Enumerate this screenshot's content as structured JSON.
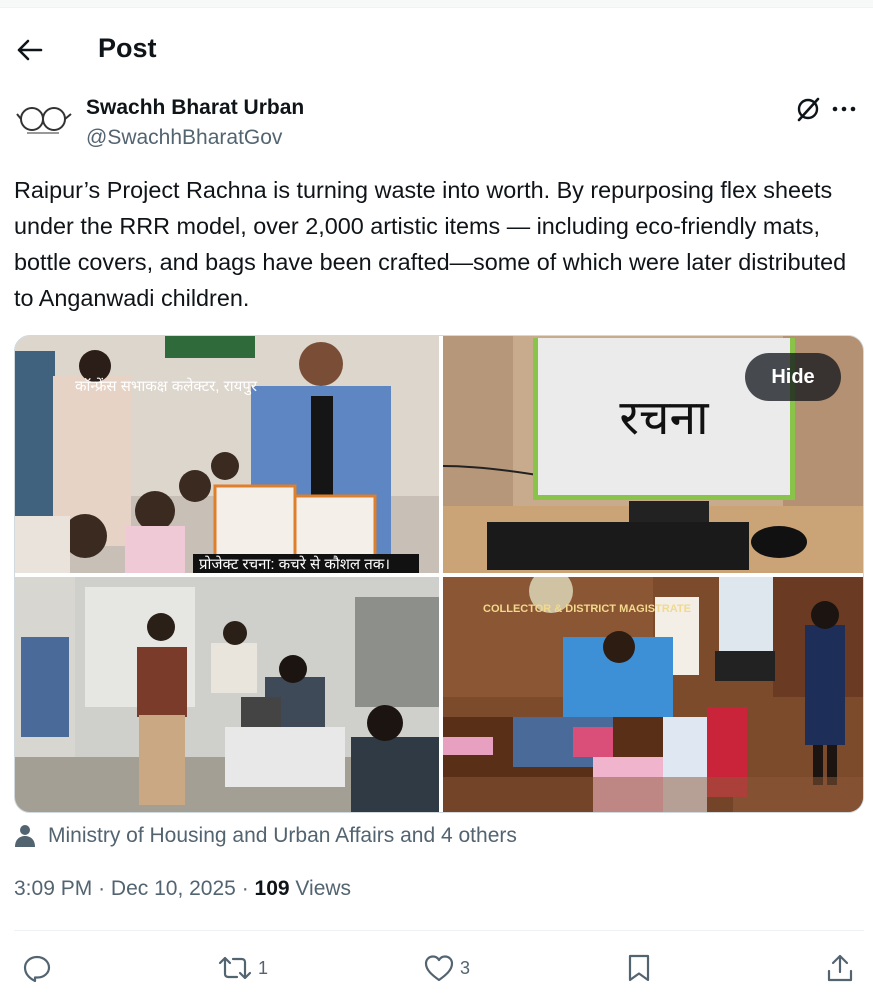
{
  "header": {
    "title": "Post"
  },
  "author": {
    "name": "Swachh Bharat Urban",
    "handle": "@SwachhBharatGov"
  },
  "tweet": {
    "text": "Raipur’s Project Rachna is turning waste into worth. By repurposing flex sheets under the RRR model, over 2,000 artistic items — including eco-friendly mats, bottle covers, and bags have been crafted—some of which were later distributed to Anganwadi children."
  },
  "media": {
    "hide_label": "Hide",
    "image1_sign": "कॉन्फ्रेंस सभाकक्ष कलेक्टर, रायपुर",
    "image1_caption": "प्रोजेक्ट रचना: कचरे से कौशल तक।",
    "image2_placard": "रचना",
    "image4_sign": "COLLECTOR & DISTRICT MAGISTRATE"
  },
  "tagged": {
    "text": "Ministry of Housing and Urban Affairs and 4 others"
  },
  "meta": {
    "time": "3:09 PM",
    "separator": "·",
    "date": "Dec 10, 2025",
    "views_count": "109",
    "views_label": "Views"
  },
  "actions": {
    "reply_count": "",
    "repost_count": "1",
    "like_count": "3"
  },
  "colors": {
    "text": "#0f1419",
    "secondary": "#536471",
    "divider": "#eff3f4"
  }
}
